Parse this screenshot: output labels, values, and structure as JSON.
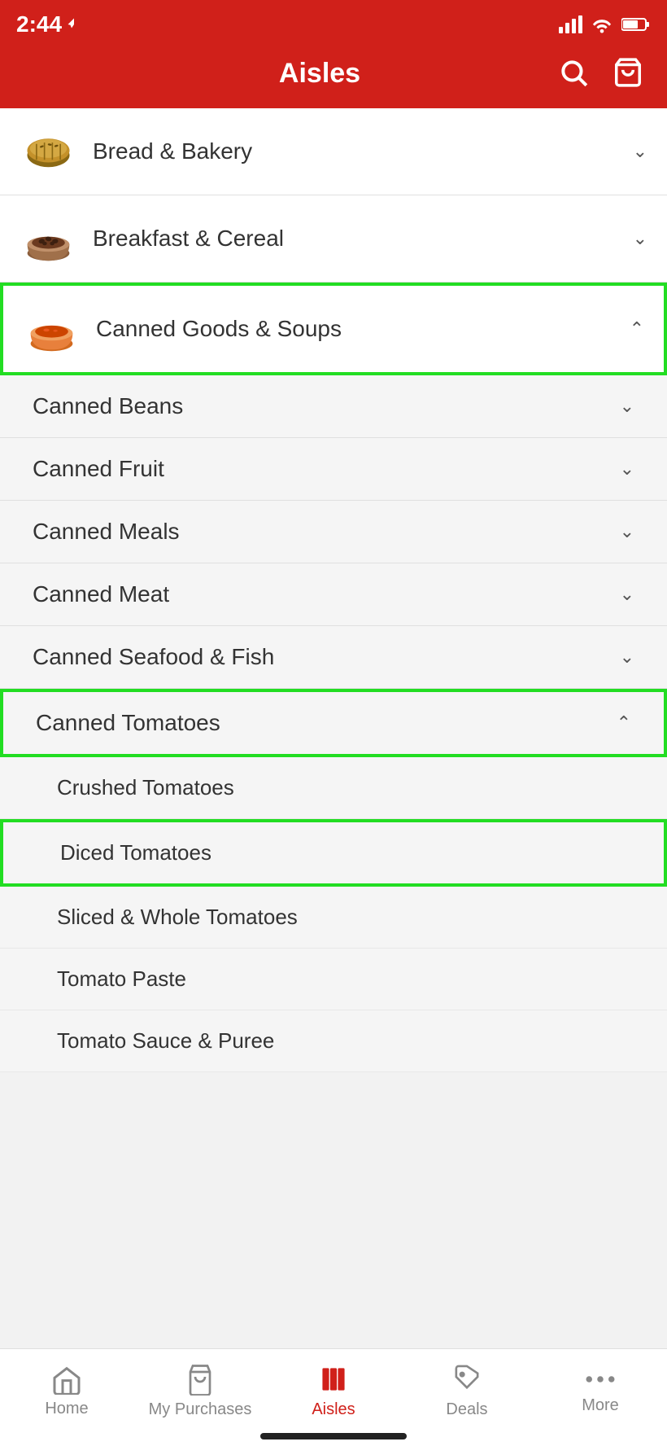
{
  "status": {
    "time": "2:44",
    "location_arrow": "➤"
  },
  "header": {
    "title": "Aisles",
    "search_label": "Search",
    "cart_label": "Cart"
  },
  "categories": [
    {
      "id": "bread-bakery",
      "label": "Bread & Bakery",
      "icon": "🍞",
      "expanded": false,
      "highlighted": false
    },
    {
      "id": "breakfast-cereal",
      "label": "Breakfast & Cereal",
      "icon": "🥣",
      "expanded": false,
      "highlighted": false
    },
    {
      "id": "canned-goods",
      "label": "Canned Goods & Soups",
      "icon": "🍲",
      "expanded": true,
      "highlighted": true,
      "subcategories": [
        {
          "id": "canned-beans",
          "label": "Canned Beans",
          "expanded": false,
          "highlighted": false
        },
        {
          "id": "canned-fruit",
          "label": "Canned Fruit",
          "expanded": false,
          "highlighted": false
        },
        {
          "id": "canned-meals",
          "label": "Canned Meals",
          "expanded": false,
          "highlighted": false
        },
        {
          "id": "canned-meat",
          "label": "Canned Meat",
          "expanded": false,
          "highlighted": false
        },
        {
          "id": "canned-seafood",
          "label": "Canned Seafood & Fish",
          "expanded": false,
          "highlighted": false
        },
        {
          "id": "canned-tomatoes",
          "label": "Canned Tomatoes",
          "expanded": true,
          "highlighted": true,
          "items": [
            {
              "id": "crushed-tomatoes",
              "label": "Crushed Tomatoes",
              "highlighted": false
            },
            {
              "id": "diced-tomatoes",
              "label": "Diced Tomatoes",
              "highlighted": true
            },
            {
              "id": "sliced-whole-tomatoes",
              "label": "Sliced & Whole Tomatoes",
              "highlighted": false
            },
            {
              "id": "tomato-paste",
              "label": "Tomato Paste",
              "highlighted": false
            },
            {
              "id": "tomato-sauce-puree",
              "label": "Tomato Sauce & Puree",
              "highlighted": false
            }
          ]
        }
      ]
    }
  ],
  "bottom_nav": [
    {
      "id": "home",
      "label": "Home",
      "icon": "house",
      "active": false
    },
    {
      "id": "my-purchases",
      "label": "My Purchases",
      "icon": "bag",
      "active": false
    },
    {
      "id": "aisles",
      "label": "Aisles",
      "icon": "aisles",
      "active": true
    },
    {
      "id": "deals",
      "label": "Deals",
      "icon": "tag",
      "active": false
    },
    {
      "id": "more",
      "label": "More",
      "icon": "dots",
      "active": false
    }
  ]
}
